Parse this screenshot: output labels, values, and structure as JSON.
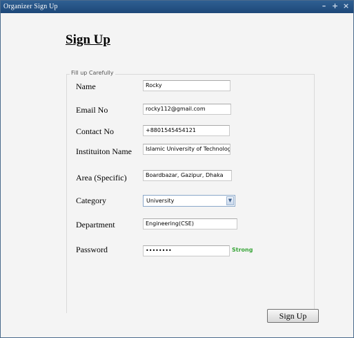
{
  "window": {
    "title": "Organizer Sign Up",
    "controls": {
      "minimize": "–",
      "maximize": "+",
      "close": "×"
    }
  },
  "form": {
    "heading": "Sign Up",
    "group_title": "Fill up Carefully",
    "fields": {
      "name": {
        "label": "Name",
        "value": "Rocky"
      },
      "email": {
        "label": "Email No",
        "value": "rocky112@gmail.com"
      },
      "contact": {
        "label": "Contact No",
        "value": "+8801545454121"
      },
      "institution": {
        "label": "Instituiton Name",
        "value": "Islamic University of Technology"
      },
      "area": {
        "label": "Area (Specific)",
        "value": "Boardbazar, Gazipur, Dhaka"
      },
      "category": {
        "label": "Category",
        "selected": "University",
        "arrow_icon": "chevron-down-icon"
      },
      "department": {
        "label": "Department",
        "value": "Engineering(CSE)"
      },
      "password": {
        "label": "Password",
        "masked_value": "••••••••",
        "strength": "Strong",
        "strength_color": "#3aa63a"
      }
    },
    "submit_label": "Sign Up"
  },
  "colors": {
    "titlebar": "#1d4778",
    "background": "#f4f4f4"
  }
}
